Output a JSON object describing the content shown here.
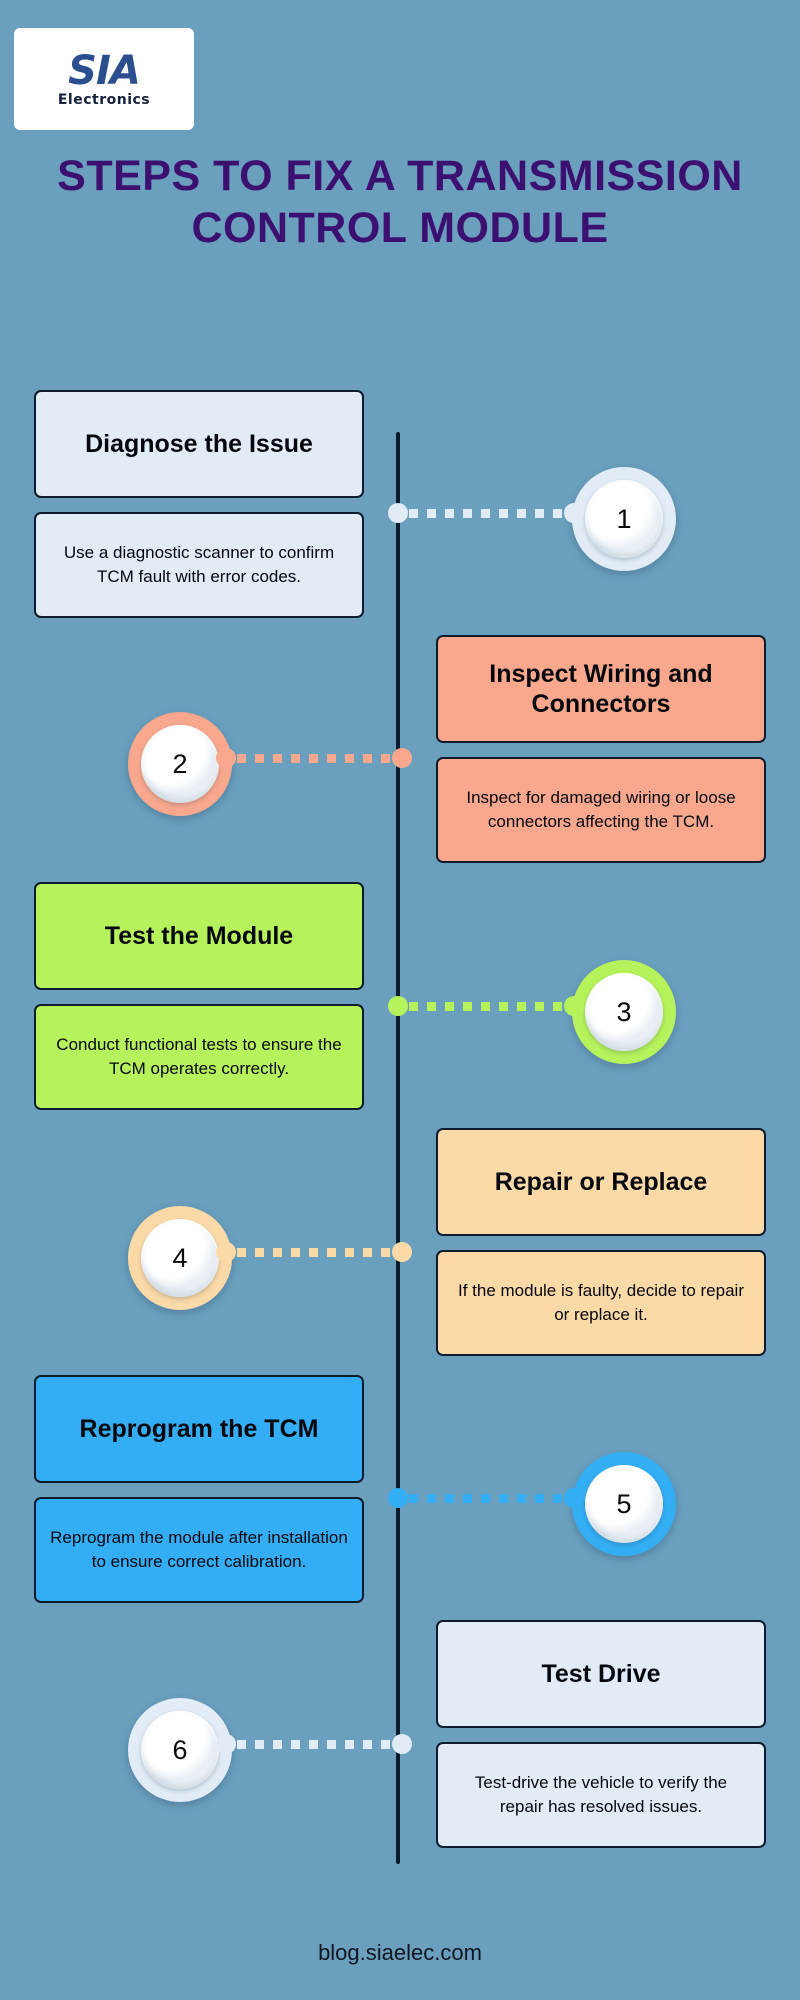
{
  "logo": {
    "main": "SIA",
    "sub": "Electronics"
  },
  "title": "STEPS TO FIX A TRANSMISSION CONTROL MODULE",
  "footer": "blog.siaelec.com",
  "theme": {
    "background": "#6a9fbe",
    "title_color": "#3b1070",
    "spine_color": "#0d1b2a",
    "box_border": "#0d1b2a",
    "text_color": "#05070d"
  },
  "steps": [
    {
      "number": "1",
      "heading": "Diagnose the Issue",
      "body": "Use a diagnostic scanner to confirm TCM fault with error codes.",
      "color": "#e1ecf7",
      "side": "left"
    },
    {
      "number": "2",
      "heading": "Inspect Wiring and Connectors",
      "body": "Inspect for damaged wiring or loose connectors affecting the TCM.",
      "color": "#f9a88e",
      "side": "right"
    },
    {
      "number": "3",
      "heading": "Test the Module",
      "body": "Conduct functional tests to ensure the TCM operates correctly.",
      "color": "#b6f25c",
      "side": "left"
    },
    {
      "number": "4",
      "heading": "Repair or Replace",
      "body": "If the module is faulty, decide to repair or replace it.",
      "color": "#fbdaa8",
      "side": "right"
    },
    {
      "number": "5",
      "heading": "Reprogram the TCM",
      "body": "Reprogram the module after installation to ensure correct calibration.",
      "color": "#33aef5",
      "side": "left"
    },
    {
      "number": "6",
      "heading": "Test Drive",
      "body": "Test-drive the vehicle to verify the repair has resolved issues.",
      "color": "#e1ecf7",
      "side": "right"
    }
  ]
}
